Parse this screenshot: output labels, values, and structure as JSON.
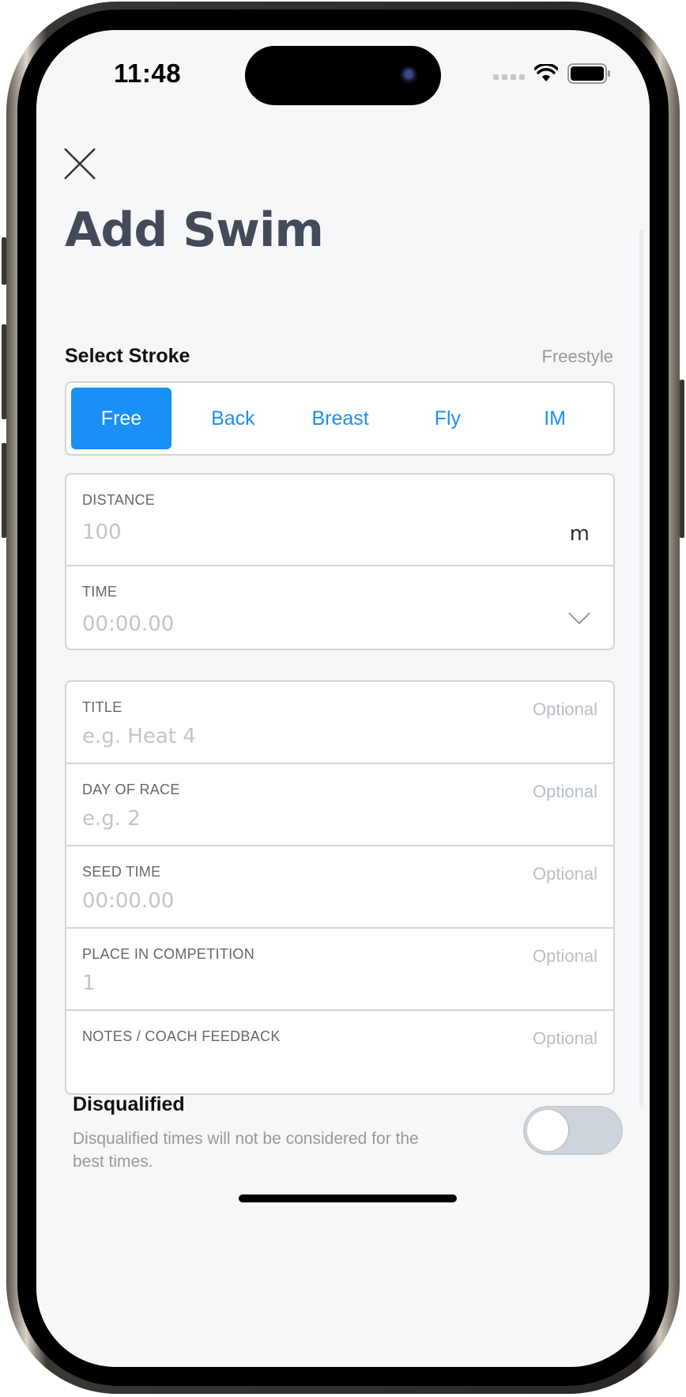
{
  "status_bar": {
    "time": "11:48",
    "icons": [
      "signal-icon",
      "wifi-icon",
      "battery-icon"
    ]
  },
  "header": {
    "close_icon": "close-icon",
    "title": "Add Swim"
  },
  "stroke": {
    "label": "Select Stroke",
    "selected_name": "Freestyle",
    "options": [
      "Free",
      "Back",
      "Breast",
      "Fly",
      "IM"
    ],
    "selected_index": 0
  },
  "main_fields": {
    "distance": {
      "label": "DISTANCE",
      "placeholder": "100",
      "unit": "m"
    },
    "time": {
      "label": "TIME",
      "placeholder": "00:00.00",
      "chevron_icon": "chevron-down-icon"
    }
  },
  "optional_fields": [
    {
      "label": "TITLE",
      "optional": "Optional",
      "placeholder": "e.g. Heat 4"
    },
    {
      "label": "DAY OF RACE",
      "optional": "Optional",
      "placeholder": "e.g. 2"
    },
    {
      "label": "SEED TIME",
      "optional": "Optional",
      "placeholder": "00:00.00"
    },
    {
      "label": "PLACE IN COMPETITION",
      "optional": "Optional",
      "placeholder": "1"
    },
    {
      "label": "NOTES / COACH FEEDBACK",
      "optional": "Optional",
      "placeholder": ""
    }
  ],
  "disqualified": {
    "title": "Disqualified",
    "description": "Disqualified times will not be considered for the best times.",
    "enabled": false
  },
  "colors": {
    "accent": "#1a8ff5",
    "title": "#434a59",
    "background": "#f6f7f9",
    "toggle_off": "#cdd4da"
  }
}
